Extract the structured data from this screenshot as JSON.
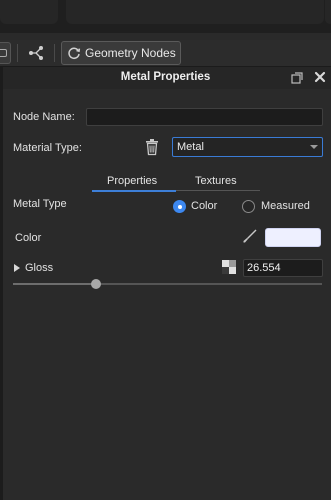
{
  "toolbar": {
    "geometry_nodes_label": "Geometry Nodes",
    "icons": [
      "panel-toggle-icon",
      "branch-icon",
      "refresh-icon"
    ]
  },
  "panel": {
    "title": "Metal Properties",
    "icons": [
      "undock-icon",
      "close-icon"
    ]
  },
  "fields": {
    "node_name_label": "Node Name:",
    "node_name_value": "",
    "material_type_label": "Material Type:",
    "material_type_value": "Metal"
  },
  "tabs": [
    {
      "label": "Properties",
      "active": true
    },
    {
      "label": "Textures",
      "active": false
    }
  ],
  "metal_type": {
    "label": "Metal Type",
    "options": [
      {
        "label": "Color",
        "selected": true
      },
      {
        "label": "Measured",
        "selected": false
      }
    ]
  },
  "color": {
    "label": "Color",
    "swatch_hex": "#eef0ff"
  },
  "gloss": {
    "label": "Gloss",
    "value": "26.554",
    "slider_fraction": 0.27
  },
  "colors": {
    "accent": "#3d7fd8",
    "panel_bg": "#2a2a2a"
  }
}
